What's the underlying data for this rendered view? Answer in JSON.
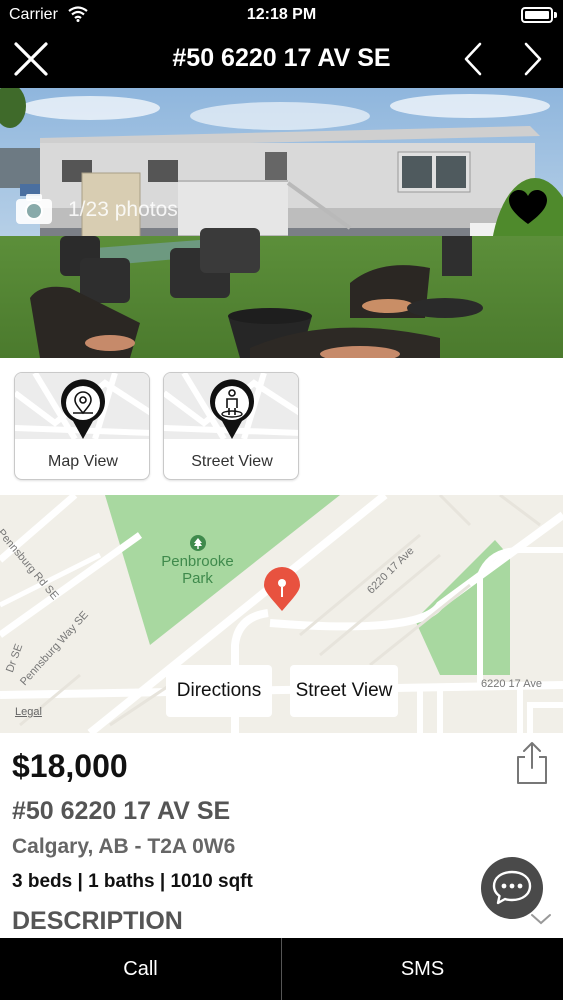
{
  "status_bar": {
    "carrier": "Carrier",
    "time": "12:18 PM"
  },
  "nav": {
    "title": "#50 6220 17 AV SE"
  },
  "photo": {
    "count_text": "1/23 photos"
  },
  "view_buttons": {
    "map_view": "Map View",
    "street_view": "Street View"
  },
  "map": {
    "park_name": "Penbrooke\nPark",
    "streets": [
      "Pennsburg Rd SE",
      "Pennsburg Way SE",
      "Dr SE",
      "6220 17 Ave",
      "6220 17 Ave"
    ],
    "legal": "Legal",
    "directions_label": "Directions",
    "street_view_label": "Street View"
  },
  "listing": {
    "price": "$18,000",
    "address": "#50 6220 17 AV SE",
    "city": "Calgary, AB - T2A 0W6",
    "specs": "3 beds | 1 baths | 1010 sqft",
    "description_heading": "DESCRIPTION"
  },
  "tab_bar": {
    "call": "Call",
    "sms": "SMS"
  },
  "colors": {
    "bar_bg": "#000000",
    "pin_red": "#e8523f",
    "park_green": "#a8d8a0",
    "map_bg": "#f1efe8"
  }
}
